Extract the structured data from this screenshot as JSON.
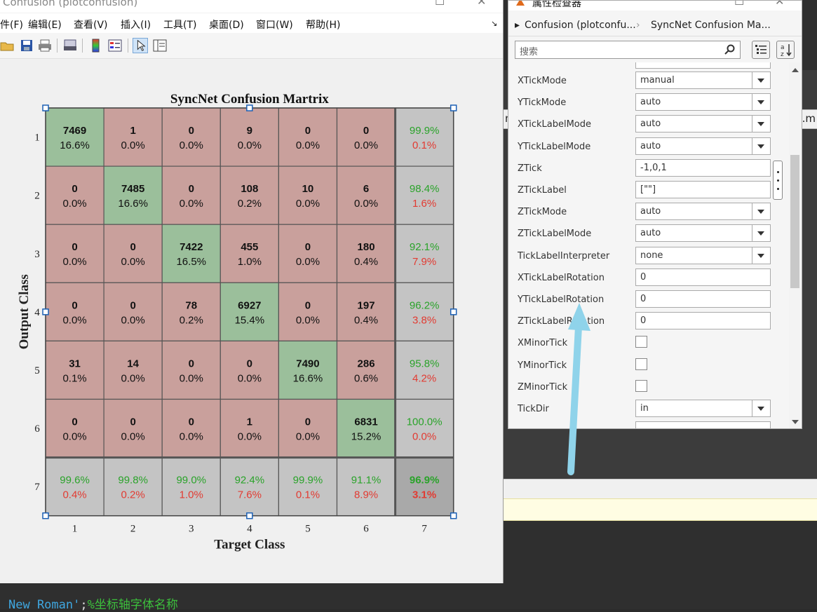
{
  "figure_window": {
    "title": "Confusion (plotconfusion)",
    "menus": [
      "件(F)",
      "编辑(E)",
      "查看(V)",
      "插入(I)",
      "工具(T)",
      "桌面(D)",
      "窗口(W)",
      "帮助(H)"
    ],
    "toolbar_icons": [
      "open-folder-icon",
      "save-icon",
      "print-icon",
      "print-preview-icon",
      "colorbar-icon",
      "legend-icon",
      "pointer-icon",
      "property-editor-icon"
    ]
  },
  "chart_data": {
    "type": "heatmap",
    "title": "SyncNet Confusion Martrix",
    "xlabel": "Target Class",
    "ylabel": "Output Class",
    "x_tick_labels": [
      "1",
      "2",
      "3",
      "4",
      "5",
      "6",
      "7"
    ],
    "y_tick_labels": [
      "1",
      "2",
      "3",
      "4",
      "5",
      "6",
      "7"
    ],
    "cells": [
      [
        [
          "7469",
          "16.6%"
        ],
        [
          "1",
          "0.0%"
        ],
        [
          "0",
          "0.0%"
        ],
        [
          "9",
          "0.0%"
        ],
        [
          "0",
          "0.0%"
        ],
        [
          "0",
          "0.0%"
        ]
      ],
      [
        [
          "0",
          "0.0%"
        ],
        [
          "7485",
          "16.6%"
        ],
        [
          "0",
          "0.0%"
        ],
        [
          "108",
          "0.2%"
        ],
        [
          "10",
          "0.0%"
        ],
        [
          "6",
          "0.0%"
        ]
      ],
      [
        [
          "0",
          "0.0%"
        ],
        [
          "0",
          "0.0%"
        ],
        [
          "7422",
          "16.5%"
        ],
        [
          "455",
          "1.0%"
        ],
        [
          "0",
          "0.0%"
        ],
        [
          "180",
          "0.4%"
        ]
      ],
      [
        [
          "0",
          "0.0%"
        ],
        [
          "0",
          "0.0%"
        ],
        [
          "78",
          "0.2%"
        ],
        [
          "6927",
          "15.4%"
        ],
        [
          "0",
          "0.0%"
        ],
        [
          "197",
          "0.4%"
        ]
      ],
      [
        [
          "31",
          "0.1%"
        ],
        [
          "14",
          "0.0%"
        ],
        [
          "0",
          "0.0%"
        ],
        [
          "0",
          "0.0%"
        ],
        [
          "7490",
          "16.6%"
        ],
        [
          "286",
          "0.6%"
        ]
      ],
      [
        [
          "0",
          "0.0%"
        ],
        [
          "0",
          "0.0%"
        ],
        [
          "0",
          "0.0%"
        ],
        [
          "1",
          "0.0%"
        ],
        [
          "0",
          "0.0%"
        ],
        [
          "6831",
          "15.2%"
        ]
      ]
    ],
    "row_summary": [
      [
        "99.9%",
        "0.1%"
      ],
      [
        "98.4%",
        "1.6%"
      ],
      [
        "92.1%",
        "7.9%"
      ],
      [
        "96.2%",
        "3.8%"
      ],
      [
        "95.8%",
        "4.2%"
      ],
      [
        "100.0%",
        "0.0%"
      ]
    ],
    "col_summary": [
      [
        "99.6%",
        "0.4%"
      ],
      [
        "99.8%",
        "0.2%"
      ],
      [
        "99.0%",
        "1.0%"
      ],
      [
        "92.4%",
        "7.6%"
      ],
      [
        "99.9%",
        "0.1%"
      ],
      [
        "91.1%",
        "8.9%"
      ]
    ],
    "overall": [
      "96.9%",
      "3.1%"
    ],
    "colors": {
      "correct": "#9bbf9b",
      "incorrect": "#c9a09c",
      "summary": "#c4c4c4",
      "overall": "#a9a9a9",
      "green_text": "#2aa32a",
      "red_text": "#e23b32"
    }
  },
  "inspector": {
    "title": "属性检查器",
    "breadcrumb": [
      "Confusion (plotconfu...",
      "SyncNet Confusion Ma..."
    ],
    "search_placeholder": "搜索",
    "properties": [
      {
        "name": "XTickMode",
        "value": "manual",
        "type": "dropdown"
      },
      {
        "name": "YTickMode",
        "value": "auto",
        "type": "dropdown"
      },
      {
        "name": "XTickLabelMode",
        "value": "auto",
        "type": "dropdown"
      },
      {
        "name": "YTickLabelMode",
        "value": "auto",
        "type": "dropdown"
      },
      {
        "name": "ZTick",
        "value": "-1,0,1",
        "type": "text"
      },
      {
        "name": "ZTickLabel",
        "value": "[\"\"]",
        "type": "text"
      },
      {
        "name": "ZTickMode",
        "value": "auto",
        "type": "dropdown"
      },
      {
        "name": "ZTickLabelMode",
        "value": "auto",
        "type": "dropdown"
      },
      {
        "name": "TickLabelInterpreter",
        "value": "none",
        "type": "dropdown"
      },
      {
        "name": "XTickLabelRotation",
        "value": "0",
        "type": "text"
      },
      {
        "name": "YTickLabelRotation",
        "value": "0",
        "type": "text"
      },
      {
        "name": "ZTickLabelRotation",
        "value": "0",
        "type": "text"
      },
      {
        "name": "XMinorTick",
        "value": "",
        "type": "checkbox"
      },
      {
        "name": "YMinorTick",
        "value": "",
        "type": "checkbox"
      },
      {
        "name": "ZMinorTick",
        "value": "",
        "type": "checkbox"
      },
      {
        "name": "TickDir",
        "value": "in",
        "type": "dropdown"
      }
    ]
  },
  "editor_line": {
    "part1": "New Roman'",
    "part2": ";",
    "part3": "%坐标轴字体名称"
  },
  "annotation_color": "#8fd3ea"
}
